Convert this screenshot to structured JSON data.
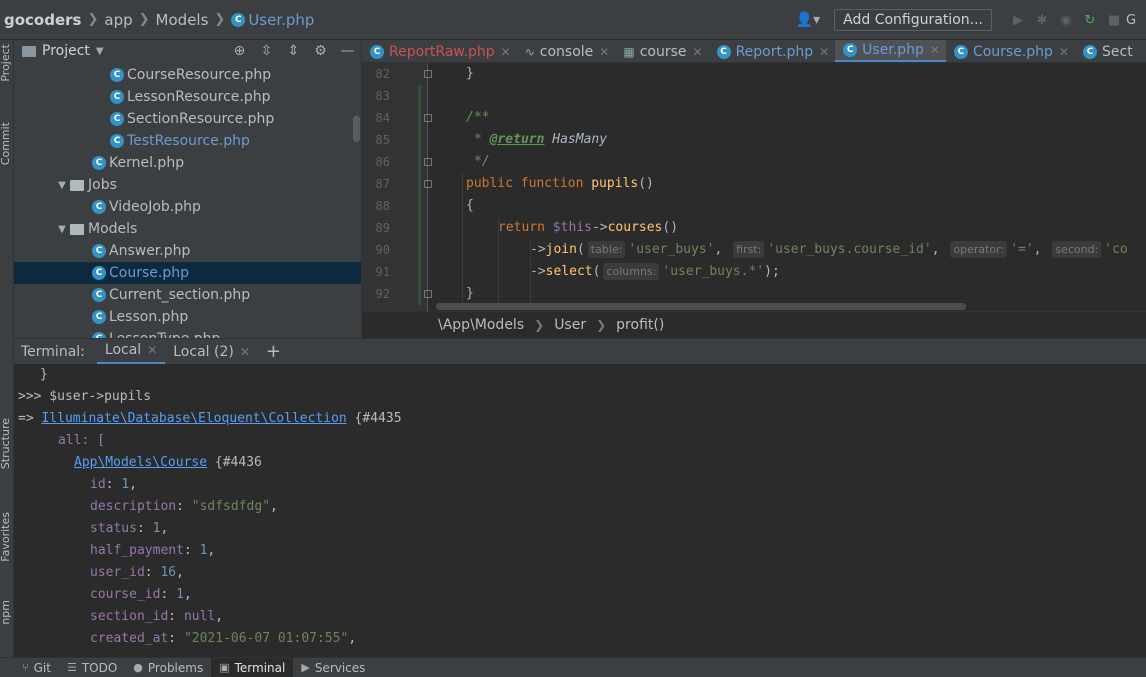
{
  "navbar": {
    "crumbs": [
      "gocoders",
      "app",
      "Models",
      "User.php"
    ],
    "add_config_label": "Add Configuration..."
  },
  "side_stripe": {
    "items": [
      "Project",
      "Commit",
      "Structure",
      "Favorites",
      "npm"
    ]
  },
  "project": {
    "title": "Project",
    "tree": [
      {
        "label": "CourseResource.php",
        "type": "class",
        "indent": 3,
        "selected": false,
        "color": "normal"
      },
      {
        "label": "LessonResource.php",
        "type": "class",
        "indent": 3,
        "selected": false,
        "color": "normal"
      },
      {
        "label": "SectionResource.php",
        "type": "class",
        "indent": 3,
        "selected": false,
        "color": "normal"
      },
      {
        "label": "TestResource.php",
        "type": "class",
        "indent": 3,
        "selected": false,
        "color": "blue"
      },
      {
        "label": "Kernel.php",
        "type": "class",
        "indent": 2,
        "selected": false,
        "color": "normal"
      },
      {
        "label": "Jobs",
        "type": "folder",
        "indent": 1,
        "selected": false,
        "color": "normal"
      },
      {
        "label": "VideoJob.php",
        "type": "class",
        "indent": 2,
        "selected": false,
        "color": "normal"
      },
      {
        "label": "Models",
        "type": "folder",
        "indent": 1,
        "selected": false,
        "color": "normal"
      },
      {
        "label": "Answer.php",
        "type": "class",
        "indent": 2,
        "selected": false,
        "color": "normal"
      },
      {
        "label": "Course.php",
        "type": "class",
        "indent": 2,
        "selected": true,
        "color": "blue"
      },
      {
        "label": "Current_section.php",
        "type": "class",
        "indent": 2,
        "selected": false,
        "color": "normal"
      },
      {
        "label": "Lesson.php",
        "type": "class",
        "indent": 2,
        "selected": false,
        "color": "normal"
      },
      {
        "label": "LessonType.php",
        "type": "class",
        "indent": 2,
        "selected": false,
        "color": "normal"
      }
    ]
  },
  "editor_tabs": [
    {
      "label": "ReportRaw.php",
      "style": "red",
      "icon": "class-icon"
    },
    {
      "label": "console",
      "style": "normal",
      "icon": "console-icon"
    },
    {
      "label": "course",
      "style": "normal",
      "icon": "table-icon"
    },
    {
      "label": "Report.php",
      "style": "blue",
      "icon": "class-icon"
    },
    {
      "label": "User.php",
      "style": "blue",
      "active": true,
      "icon": "class-icon"
    },
    {
      "label": "Course.php",
      "style": "blue",
      "icon": "class-icon"
    },
    {
      "label": "Sect",
      "style": "normal",
      "icon": "class-icon"
    }
  ],
  "editor": {
    "line_numbers": [
      "82",
      "83",
      "84",
      "85",
      "86",
      "87",
      "88",
      "89",
      "90",
      "91",
      "92"
    ],
    "code": {
      "l82": "}",
      "l84": "/**",
      "l85_star": "* ",
      "l85_tag": "@return",
      "l85_type": "HasMany",
      "l86": "*/",
      "l87_kw": "public function ",
      "l87_fn": "pupils",
      "l87_rest": "()",
      "l88": "{",
      "l89_kw": "return ",
      "l89_var": "$this",
      "l89_arrow": "->",
      "l89_fn": "courses",
      "l89_rest": "()",
      "l90_pre": "->",
      "l90_fn": "join",
      "l90_open": "(",
      "l90_h1": "table:",
      "l90_s1": "'user_buys'",
      "l90_c1": ", ",
      "l90_h2": "first:",
      "l90_s2": "'user_buys.course_id'",
      "l90_c2": ", ",
      "l90_h3": "operator:",
      "l90_s3": "'='",
      "l90_c3": ", ",
      "l90_h4": "second:",
      "l90_s4": "'co",
      "l91_pre": "->",
      "l91_fn": "select",
      "l91_open": "(",
      "l91_h1": "columns:",
      "l91_s1": "'user_buys.*'",
      "l91_close": ");",
      "l92": "}"
    }
  },
  "code_crumbs": [
    "\\App\\Models",
    "User",
    "profit()"
  ],
  "terminal": {
    "title": "Terminal:",
    "tabs": [
      {
        "label": "Local",
        "active": true
      },
      {
        "label": "Local (2)",
        "active": false
      }
    ],
    "lines": {
      "t0": "}",
      "t1": ">>> $user->pupils",
      "t2_pre": "=> ",
      "t2_link": "Illuminate\\Database\\Eloquent\\Collection",
      "t2_post": " {#4435",
      "t3": "all: [",
      "t4_link": "App\\Models\\Course",
      "t4_post": " {#4436",
      "f1_key": "id",
      "f1_val": "1",
      "f2_key": "description",
      "f2_val": "\"sdfsdfdg\"",
      "f3_key": "status",
      "f3_val": "1",
      "f4_key": "half_payment",
      "f4_val": "1",
      "f5_key": "user_id",
      "f5_val": "16",
      "f6_key": "course_id",
      "f6_val": "1",
      "f7_key": "section_id",
      "f7_val": "null",
      "f8_key": "created_at",
      "f8_val": "\"2021-06-07 01:07:55\""
    }
  },
  "bottom_bar": [
    {
      "label": "Git",
      "icon": "git-icon"
    },
    {
      "label": "TODO",
      "icon": "todo-icon"
    },
    {
      "label": "Problems",
      "icon": "problems-icon"
    },
    {
      "label": "Terminal",
      "icon": "terminal-icon",
      "active": true
    },
    {
      "label": "Services",
      "icon": "services-icon"
    }
  ]
}
